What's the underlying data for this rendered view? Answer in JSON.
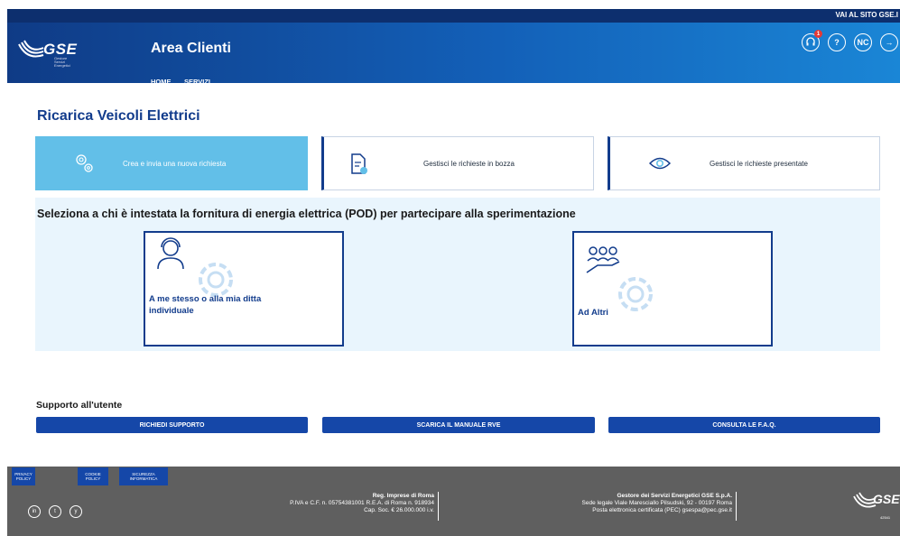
{
  "top_link": "VAI AL SITO GSE.I",
  "header": {
    "logo_text": "GSE",
    "logo_sub": [
      "Gestore",
      "Servizi",
      "Energetici"
    ],
    "app_title": "Area Clienti",
    "nav": [
      "HOME",
      "SERVIZI"
    ],
    "notification_count": "1",
    "user_initials": "NC"
  },
  "page_title": "Ricarica Veicoli Elettrici",
  "tabs": [
    {
      "label": "Crea e invia una nuova richiesta",
      "icon": "gears-icon"
    },
    {
      "label": "Gestisci le richieste in bozza",
      "icon": "document-edit-icon"
    },
    {
      "label": "Gestisci le richieste presentate",
      "icon": "eye-icon"
    }
  ],
  "pod": {
    "heading": "Seleziona a chi è intestata la fornitura di energia elettrica (POD) per partecipare alla sperimentazione",
    "options": [
      {
        "label_line1": "A me stesso o alla mia ditta",
        "label_line2": "individuale"
      },
      {
        "label": "Ad Altri"
      }
    ]
  },
  "support": {
    "heading": "Supporto all'utente",
    "buttons": [
      "RICHIEDI SUPPORTO",
      "SCARICA IL MANUALE RVE",
      "CONSULTA LE F.A.Q."
    ]
  },
  "footer": {
    "policies": [
      {
        "line1": "PRIVACY",
        "line2": "POLICY"
      },
      {
        "line1": "COOKIE",
        "line2": "POLICY"
      },
      {
        "line1": "SICUREZZA",
        "line2": "INFORMATICA"
      }
    ],
    "social": [
      "in",
      "t",
      "y"
    ],
    "reg_title": "Reg. Imprese di Roma",
    "reg_line1": "P.IVA e C.F. n. 05754381001 R.E.A. di Roma n. 918934",
    "reg_line2": "Cap. Soc. € 26.000.000 i.v.",
    "company_title": "Gestore dei Servizi Energetici GSE S.p.A.",
    "company_line1": "Sede legale Viale Maresciallo Pilsudski, 92 - 00197 Roma",
    "company_line2": "Posta elettronica certificata (PEC) gsespa@pec.gse.it",
    "logo_text": "GSE",
    "logo_num": "42541"
  },
  "colors": {
    "primary": "#123c8c",
    "button_blue": "#1547a8",
    "active_tab": "#62bfe8",
    "section_bg": "#e9f5fd",
    "footer_bg": "#5f5f5f"
  }
}
